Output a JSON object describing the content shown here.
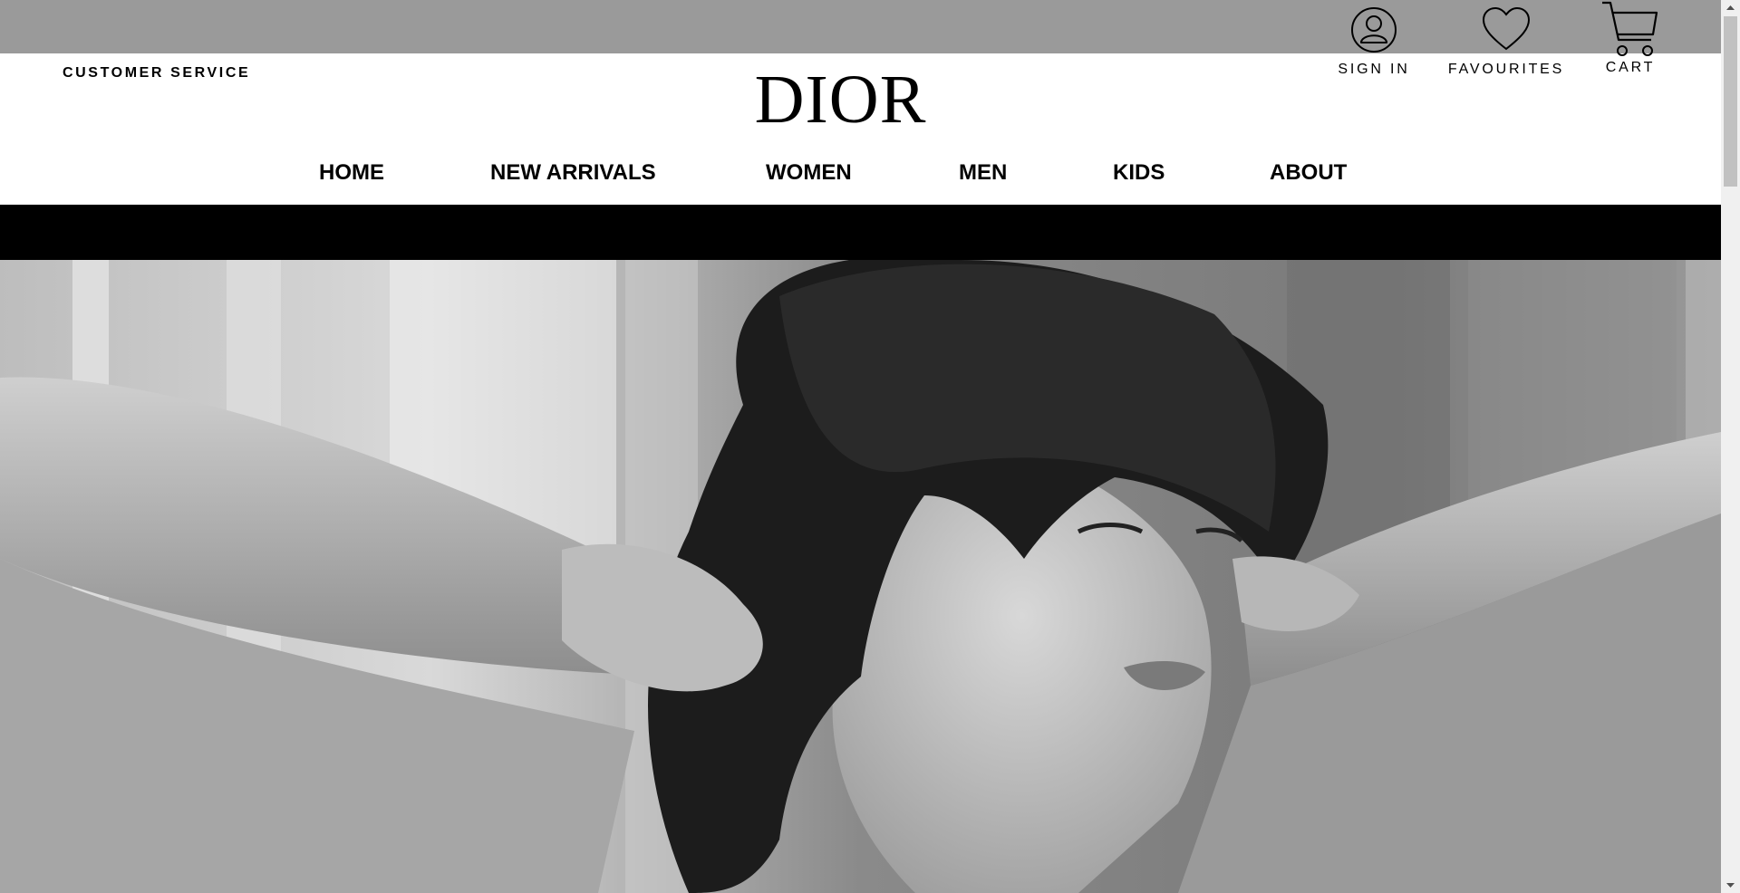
{
  "header": {
    "customer_service": "CUSTOMER SERVICE",
    "logo": "DIOR",
    "utility": {
      "sign_in": {
        "label": "SIGN IN",
        "icon": "user-icon"
      },
      "favourites": {
        "label": "FAVOURITES",
        "icon": "heart-icon"
      },
      "cart": {
        "label": "CART",
        "icon": "cart-icon"
      }
    }
  },
  "nav": {
    "items": [
      "HOME",
      "NEW ARRIVALS",
      "WOMEN",
      "MEN",
      "KIDS",
      "ABOUT"
    ]
  },
  "hero": {
    "description": "Black and white photo of a woman with dark bob haircut and bangs, hands raised behind her neck"
  },
  "colors": {
    "top_strip": "#9a9a9a",
    "header_bg": "#ffffff",
    "bar": "#000000",
    "text": "#000000"
  }
}
